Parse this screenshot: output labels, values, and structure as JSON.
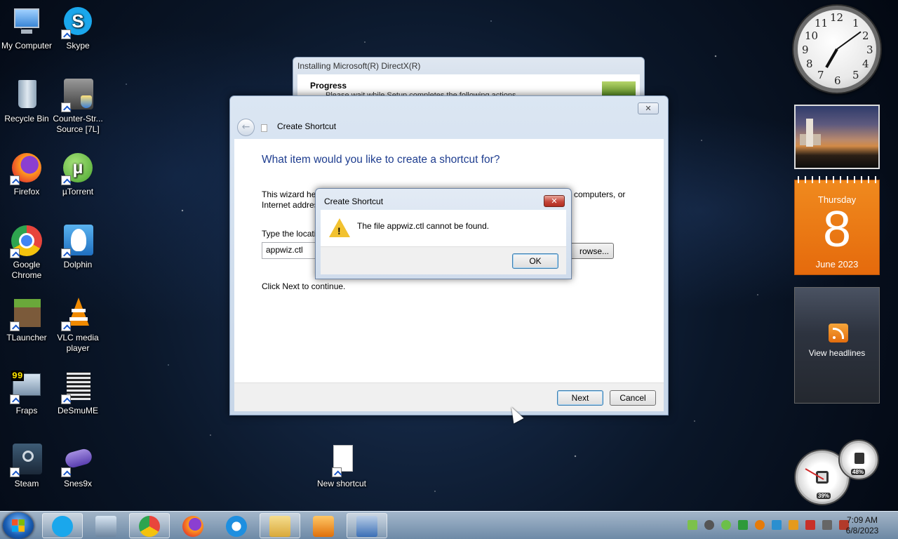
{
  "desktop": {
    "icons": [
      {
        "label": "My Computer",
        "icon": "computer-icon",
        "color": "#5aa0e6"
      },
      {
        "label": "Skype",
        "icon": "skype-icon",
        "color": "#1aa7ec"
      },
      {
        "label": "Recycle Bin",
        "icon": "recycle-bin-icon",
        "color": "#9fb6c9"
      },
      {
        "label": "Counter-Str... Source [7L]",
        "icon": "counter-strike-icon",
        "color": "#6f6f6f"
      },
      {
        "label": "Firefox",
        "icon": "firefox-icon",
        "color": "#ff7a1a"
      },
      {
        "label": "µTorrent",
        "icon": "utorrent-icon",
        "color": "#6cc04a"
      },
      {
        "label": "Google Chrome",
        "icon": "chrome-icon",
        "color": "#e8453c"
      },
      {
        "label": "Dolphin",
        "icon": "dolphin-icon",
        "color": "#3fa2e8"
      },
      {
        "label": "TLauncher",
        "icon": "tlauncher-icon",
        "color": "#5c8a34"
      },
      {
        "label": "VLC media player",
        "icon": "vlc-icon",
        "color": "#f08a00"
      },
      {
        "label": "Fraps",
        "icon": "fraps-icon",
        "color": "#333333"
      },
      {
        "label": "DeSmuME",
        "icon": "desmume-icon",
        "color": "#222222"
      },
      {
        "label": "Steam",
        "icon": "steam-icon",
        "color": "#2a475e"
      },
      {
        "label": "Snes9x",
        "icon": "snes9x-icon",
        "color": "#6a4fb8"
      },
      {
        "label": "New shortcut",
        "icon": "file-icon",
        "color": "#ffffff"
      }
    ]
  },
  "directx_window": {
    "title": "Installing Microsoft(R) DirectX(R)",
    "progress_label": "Progress",
    "subtitle": "Please wait while Setup completes the following actions."
  },
  "wizard": {
    "title": "Create Shortcut",
    "close_glyph": "✕",
    "back_glyph": "←",
    "heading": "What item would you like to create a shortcut for?",
    "description_left": "This wizard hel",
    "description_right": "computers, or",
    "description_line2": "Internet addres",
    "location_label": "Type the locati",
    "location_value": "appwiz.ctl",
    "browse_label": "rowse...",
    "continue_text": "Click Next to continue.",
    "next_label": "Next",
    "cancel_label": "Cancel"
  },
  "error_dialog": {
    "title": "Create Shortcut",
    "close_glyph": "✕",
    "warning_mark": "!",
    "message": "The file appwiz.ctl cannot be found.",
    "ok_label": "OK"
  },
  "gadgets": {
    "clock": {
      "numbers": [
        "12",
        "1",
        "2",
        "3",
        "4",
        "5",
        "6",
        "7",
        "8",
        "9",
        "10",
        "11"
      ],
      "time": "7:09"
    },
    "calendar": {
      "day": "Thursday",
      "date": "8",
      "month": "June 2023"
    },
    "feed": {
      "text": "View headlines"
    },
    "meters": {
      "cpu": "39%",
      "memory": "48%"
    }
  },
  "taskbar": {
    "items": [
      {
        "icon": "skype-icon",
        "color": "#1aa7ec"
      },
      {
        "icon": "fraps-icon",
        "color": "#444444"
      },
      {
        "icon": "chrome-icon",
        "color": "#e8453c"
      },
      {
        "icon": "firefox-icon",
        "color": "#ff7a1a"
      },
      {
        "icon": "internet-explorer-icon",
        "color": "#1e8fe0"
      },
      {
        "icon": "file-explorer-icon",
        "color": "#e9c25a"
      },
      {
        "icon": "media-player-icon",
        "color": "#f08a00"
      },
      {
        "icon": "directx-setup-icon",
        "color": "#3b6fb6"
      }
    ],
    "tray_icons": [
      {
        "icon": "tray-app-icon",
        "color": "#7cc14b"
      },
      {
        "icon": "tray-refresh-icon",
        "color": "#555555"
      },
      {
        "icon": "tray-utorrent-icon",
        "color": "#6cc04a"
      },
      {
        "icon": "tray-green-icon",
        "color": "#2e9a3a"
      },
      {
        "icon": "tray-search-icon",
        "color": "#e57b0a"
      },
      {
        "icon": "tray-monitor-icon",
        "color": "#2a8fd0"
      },
      {
        "icon": "tray-warning-icon",
        "color": "#e59a1c"
      },
      {
        "icon": "tray-flag-icon",
        "color": "#c8302a"
      },
      {
        "icon": "tray-network-icon",
        "color": "#666666"
      },
      {
        "icon": "tray-volume-icon",
        "color": "#b23a2a"
      }
    ],
    "time": "7:09 AM",
    "date": "6/8/2023"
  }
}
